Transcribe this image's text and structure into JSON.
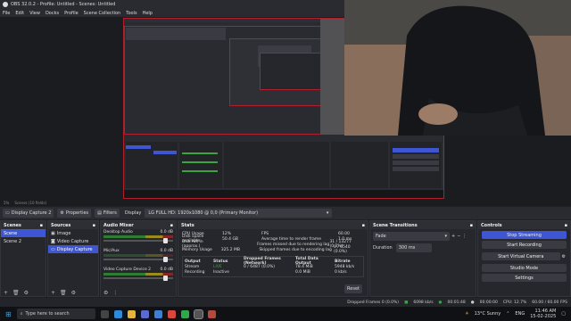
{
  "window": {
    "title": "OBS 32.0.2 - Profile: Untitled - Scenes: Untitled",
    "min": "—",
    "max": "☐",
    "close": "✕"
  },
  "menu": [
    "File",
    "Edit",
    "View",
    "Docks",
    "Profile",
    "Scene Collection",
    "Tools",
    "Help"
  ],
  "status_mini": [
    "5%",
    "Scenes (10 fields)"
  ],
  "source_bar": {
    "source": "Display Capture 2",
    "properties": "Properties",
    "filters": "Filters",
    "display_label": "Display",
    "display_value": "LG FULL HD: 1920x1080 @ 0,0 (Primary Monitor)"
  },
  "scenes": {
    "title": "Scenes",
    "items": [
      "Scene",
      "Scene 2"
    ]
  },
  "sources": {
    "title": "Sources",
    "items": [
      "Image",
      "Video Capture",
      "Display Capture"
    ]
  },
  "mixer": {
    "title": "Audio Mixer",
    "channels": [
      {
        "name": "Desktop Audio",
        "db": "0.0 dB",
        "level": 0.75
      },
      {
        "name": "Mic/Aux",
        "db": "0.0 dB",
        "level": 0.4
      },
      {
        "name": "Video Capture Device 2",
        "db": "0.0 dB",
        "level": 0.8
      }
    ]
  },
  "stats": {
    "title": "Stats",
    "rows": [
      [
        "CPU Usage",
        "12%",
        "FPS",
        "60.00"
      ],
      [
        "Disk space available",
        "50.4 GB",
        "Average time to render frame",
        "1.0 ms"
      ],
      [
        "Disk full in (approx.)",
        "",
        "Frames missed due to rendering lag",
        "31 / 13277 (0.2%)"
      ],
      [
        "Memory Usage",
        "325.2 MB",
        "Skipped frames due to encoding lag",
        "0 / 6540 (0.0%)"
      ]
    ],
    "table_headers": [
      "Output",
      "Status",
      "Dropped Frames (Network)",
      "Total Data Output",
      "Bitrate"
    ],
    "table_rows": [
      [
        "Stream",
        "LIVE",
        "0 / 6487 (0.0%)",
        "78.4 MiB",
        "5948 kb/s"
      ],
      [
        "Recording",
        "Inactive",
        "",
        "0.0 MiB",
        "0 kb/s"
      ]
    ],
    "reset": "Reset"
  },
  "transitions": {
    "title": "Scene Transitions",
    "type": "Fade",
    "duration_label": "Duration",
    "duration_value": "300 ms"
  },
  "controls": {
    "title": "Controls",
    "buttons": [
      "Stop Streaming",
      "Start Recording",
      "Start Virtual Camera",
      "Studio Mode",
      "Settings"
    ]
  },
  "statusbar": {
    "dropped": "Dropped Frames 0 (0.0%)",
    "bitrate": "6098 kb/s",
    "live_time": "00:01:48",
    "rec_time": "00:00:00",
    "cpu": "CPU: 12.7%",
    "fps": "60.00 / 60.00 FPS"
  },
  "taskbar": {
    "search": "Type here to search",
    "weather": "13°C  Sunny",
    "lang": "ENG",
    "time": "11:46 AM",
    "date": "15-02-2025"
  },
  "colors": {
    "accent": "#3e56d4",
    "border_red": "#b0202c",
    "live": "#3aa640"
  }
}
